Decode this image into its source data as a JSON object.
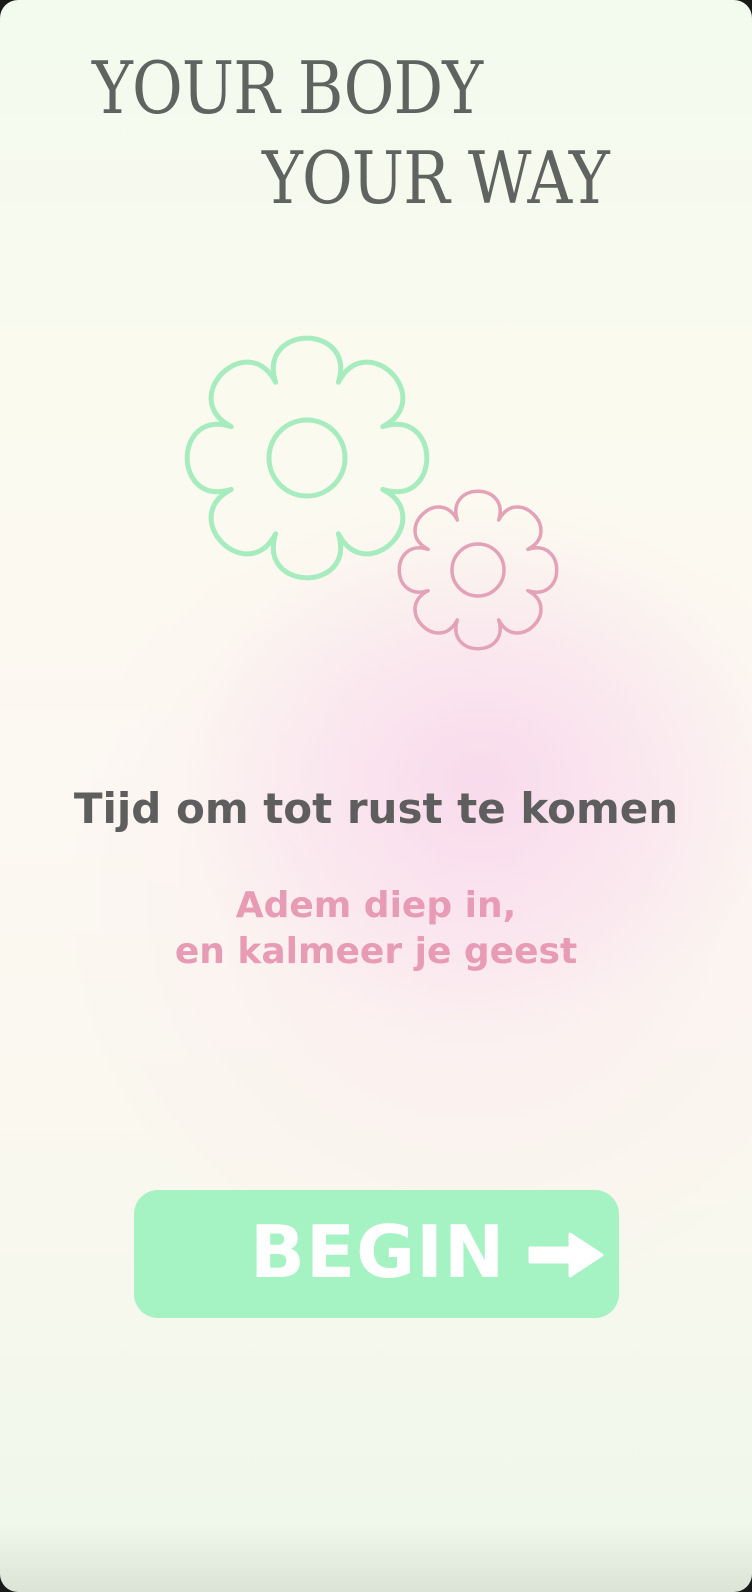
{
  "title": {
    "line1": "YOUR BODY",
    "line2": "YOUR WAY"
  },
  "illustration": {
    "icon": "flowers-icon",
    "large_flower_color": "#a6ecbf",
    "small_flower_color": "#e3a2b8"
  },
  "headline": "Tijd om tot rust te komen",
  "subtitle": {
    "line1": "Adem diep in,",
    "line2": "en kalmeer je geest"
  },
  "begin_button": {
    "label": "BEGIN",
    "icon": "arrow-right-icon"
  },
  "colors": {
    "title": "#606461",
    "headline": "#5e5e5e",
    "subtitle": "#e79bb4",
    "button_background": "#a5f2c3",
    "button_text": "#ffffff"
  }
}
